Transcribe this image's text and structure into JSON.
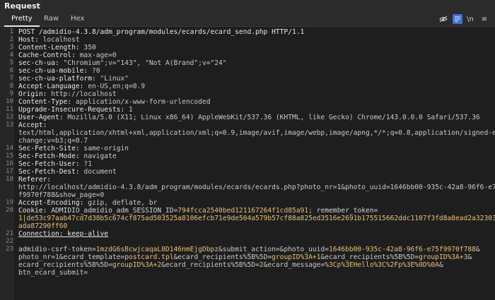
{
  "panel": {
    "title": "Request"
  },
  "tabs": [
    {
      "label": "Pretty"
    },
    {
      "label": "Raw"
    },
    {
      "label": "Hex"
    }
  ],
  "toolbar": {
    "newline_label": "\\n",
    "menu_label": "≡"
  },
  "editor": {
    "lines": [
      {
        "n": "1",
        "segs": [
          {
            "t": "POST /admidio-4.3.8/adm_program/modules/ecards/ecard_send.php HTTP/1.1",
            "c": "hn"
          }
        ]
      },
      {
        "n": "2",
        "segs": [
          {
            "t": "Host: ",
            "c": "hn"
          },
          {
            "t": "localhost",
            "c": "hv"
          }
        ]
      },
      {
        "n": "3",
        "segs": [
          {
            "t": "Content-Length: ",
            "c": "hn"
          },
          {
            "t": "350",
            "c": "hv"
          }
        ]
      },
      {
        "n": "4",
        "segs": [
          {
            "t": "Cache-Control: ",
            "c": "hn"
          },
          {
            "t": "max-age=0",
            "c": "hv"
          }
        ]
      },
      {
        "n": "5",
        "segs": [
          {
            "t": "sec-ch-ua: ",
            "c": "hn"
          },
          {
            "t": "\"Chromium\";v=\"143\", \"Not A(Brand\";v=\"24\"",
            "c": "hv"
          }
        ]
      },
      {
        "n": "6",
        "segs": [
          {
            "t": "sec-ch-ua-mobile: ",
            "c": "hn"
          },
          {
            "t": "?0",
            "c": "hv"
          }
        ]
      },
      {
        "n": "7",
        "segs": [
          {
            "t": "sec-ch-ua-platform: ",
            "c": "hn"
          },
          {
            "t": "\"Linux\"",
            "c": "hv"
          }
        ]
      },
      {
        "n": "8",
        "segs": [
          {
            "t": "Accept-Language: ",
            "c": "hn"
          },
          {
            "t": "en-US,en;q=0.9",
            "c": "hv"
          }
        ]
      },
      {
        "n": "9",
        "segs": [
          {
            "t": "Origin: ",
            "c": "hn"
          },
          {
            "t": "http://localhost",
            "c": "hv"
          }
        ]
      },
      {
        "n": "10",
        "segs": [
          {
            "t": "Content-Type: ",
            "c": "hn"
          },
          {
            "t": "application/x-www-form-urlencoded",
            "c": "hv"
          }
        ]
      },
      {
        "n": "11",
        "segs": [
          {
            "t": "Upgrade-Insecure-Requests: ",
            "c": "hn"
          },
          {
            "t": "1",
            "c": "hv"
          }
        ]
      },
      {
        "n": "12",
        "segs": [
          {
            "t": "User-Agent: ",
            "c": "hn"
          },
          {
            "t": "Mozilla/5.0 (X11; Linux x86_64) AppleWebKit/537.36 (KHTML, like Gecko) Chrome/143.0.0.0 Safari/537.36",
            "c": "hv"
          }
        ]
      },
      {
        "n": "13",
        "segs": [
          {
            "t": "Accept:",
            "c": "hn"
          }
        ]
      },
      {
        "n": "",
        "segs": [
          {
            "t": "text/html,application/xhtml+xml,application/xml;q=0.9,image/avif,image/webp,image/apng,*/*;q=0.8,application/signed-ex",
            "c": "hv"
          }
        ]
      },
      {
        "n": "",
        "segs": [
          {
            "t": "change;v=b3;q=0.7",
            "c": "hv"
          }
        ]
      },
      {
        "n": "14",
        "segs": [
          {
            "t": "Sec-Fetch-Site: ",
            "c": "hn"
          },
          {
            "t": "same-origin",
            "c": "hv"
          }
        ]
      },
      {
        "n": "15",
        "segs": [
          {
            "t": "Sec-Fetch-Mode: ",
            "c": "hn"
          },
          {
            "t": "navigate",
            "c": "hv"
          }
        ]
      },
      {
        "n": "16",
        "segs": [
          {
            "t": "Sec-Fetch-User: ",
            "c": "hn"
          },
          {
            "t": "?1",
            "c": "hv"
          }
        ]
      },
      {
        "n": "17",
        "segs": [
          {
            "t": "Sec-Fetch-Dest: ",
            "c": "hn"
          },
          {
            "t": "document",
            "c": "hv"
          }
        ]
      },
      {
        "n": "18",
        "segs": [
          {
            "t": "Referer:",
            "c": "hn"
          }
        ]
      },
      {
        "n": "",
        "segs": [
          {
            "t": "http://localhost/admidio-4.3.8/adm_program/modules/ecards/ecards.php?photo_nr=1&photo_uuid=1646bb00-935c-42a8-96f6-e75",
            "c": "hv"
          }
        ]
      },
      {
        "n": "",
        "segs": [
          {
            "t": "f9970f788&show_page=0",
            "c": "hv"
          }
        ]
      },
      {
        "n": "19",
        "segs": [
          {
            "t": "Accept-Encoding: ",
            "c": "hn"
          },
          {
            "t": "gzip, deflate, br",
            "c": "hv"
          }
        ]
      },
      {
        "n": "20",
        "segs": [
          {
            "t": "Cookie: ",
            "c": "hn"
          },
          {
            "t": "ADMIDIO_admidio_adm_SESSION_ID",
            "c": "pk"
          },
          {
            "t": "=",
            "c": "hv"
          },
          {
            "t": "794fcca2540bed121167264f1cd85a91",
            "c": "cv"
          },
          {
            "t": "; ",
            "c": "hv"
          },
          {
            "t": "remember_token",
            "c": "pk"
          },
          {
            "t": "=",
            "c": "hv"
          }
        ]
      },
      {
        "n": "",
        "segs": [
          {
            "t": "1|de53c97aab47cd7d38b5c674cf875ad503525a8106efcb71e9de504a579b57cf88a825ed3516e2691b175515662ddc1107f3fd8a8ead2a323035",
            "c": "cv"
          }
        ]
      },
      {
        "n": "",
        "segs": [
          {
            "t": "ada87290ff60",
            "c": "cv"
          }
        ]
      },
      {
        "n": "21",
        "segs": [
          {
            "t": "Connection: keep-alive",
            "c": "hn ul"
          }
        ]
      },
      {
        "n": "22",
        "segs": []
      },
      {
        "n": "23",
        "segs": [
          {
            "t": "admidio-csrf-token",
            "c": "pk"
          },
          {
            "t": "=",
            "c": "hv"
          },
          {
            "t": "1mzdG6sBcwjcaqaL0D146nmEjgDbpz",
            "c": "pv"
          },
          {
            "t": "&submit_action=&photo_uuid=",
            "c": "hv"
          },
          {
            "t": "1646bb00-935c-42a8-96f6-e75f9970f788",
            "c": "pv"
          },
          {
            "t": "&",
            "c": "hv"
          }
        ]
      },
      {
        "n": "",
        "segs": [
          {
            "t": "photo_nr=",
            "c": "hv"
          },
          {
            "t": "1",
            "c": "pv"
          },
          {
            "t": "&ecard_template=",
            "c": "hv"
          },
          {
            "t": "postcard.tpl",
            "c": "pv"
          },
          {
            "t": "&ecard_recipients%5B%5D=",
            "c": "hv"
          },
          {
            "t": "groupID%3A+1",
            "c": "pv"
          },
          {
            "t": "&ecard_recipients%5B%5D=",
            "c": "hv"
          },
          {
            "t": "groupID%3A+3",
            "c": "pv"
          },
          {
            "t": "&",
            "c": "hv"
          }
        ]
      },
      {
        "n": "",
        "segs": [
          {
            "t": "ecard_recipients%5B%5D=",
            "c": "hv"
          },
          {
            "t": "groupID%3A+2",
            "c": "pv"
          },
          {
            "t": "&ecard_recipients%5B%5D=",
            "c": "hv"
          },
          {
            "t": "2",
            "c": "pv"
          },
          {
            "t": "&ecard_message=",
            "c": "hv"
          },
          {
            "t": "%3Cp%3EHello%3C%2Fp%3E%0D%0A",
            "c": "pv"
          },
          {
            "t": "&",
            "c": "hv"
          }
        ]
      },
      {
        "n": "",
        "segs": [
          {
            "t": "btn_ecard_submit=",
            "c": "hv"
          }
        ]
      }
    ]
  }
}
